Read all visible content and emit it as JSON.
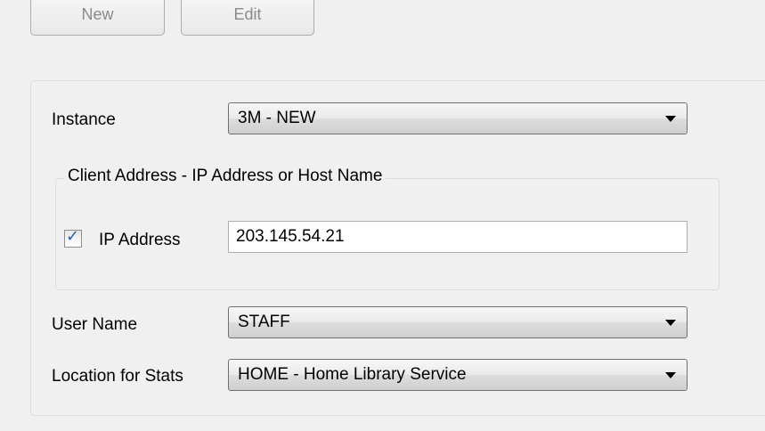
{
  "toolbar": {
    "new_label": "New",
    "edit_label": "Edit"
  },
  "form": {
    "instance_label": "Instance",
    "instance_value": "3M - NEW",
    "client_group_title": "Client Address - IP Address or Host Name",
    "ip_checkbox_checked": true,
    "ip_label": "IP Address",
    "ip_value": "203.145.54.21",
    "user_label": "User Name",
    "user_value": "STAFF",
    "location_label": "Location for Stats",
    "location_value": "HOME - Home Library Service"
  }
}
